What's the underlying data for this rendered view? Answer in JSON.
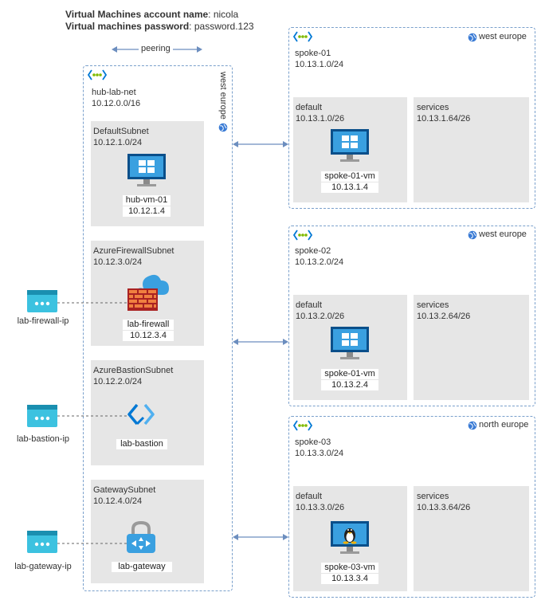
{
  "credentials": {
    "name_label": "Virtual Machines account name",
    "name_value": ": nicola",
    "password_label": "Virtual machines password",
    "password_value": ": password.123"
  },
  "peering_label": "peering",
  "hub": {
    "name": "hub-lab-net",
    "cidr": "10.12.0.0/16",
    "region": "west europe",
    "subnets": [
      {
        "name": "DefaultSubnet",
        "cidr": "10.12.1.0/24",
        "resource": "hub-vm-01",
        "ip": "10.12.1.4",
        "icon": "windows-vm-icon"
      },
      {
        "name": "AzureFirewallSubnet",
        "cidr": "10.12.3.0/24",
        "resource": "lab-firewall",
        "ip": "10.12.3.4",
        "icon": "firewall-icon"
      },
      {
        "name": "AzureBastionSubnet",
        "cidr": "10.12.2.0/24",
        "resource": "lab-bastion",
        "ip": "",
        "icon": "bastion-icon"
      },
      {
        "name": "GatewaySubnet",
        "cidr": "10.12.4.0/24",
        "resource": "lab-gateway",
        "ip": "",
        "icon": "gateway-icon"
      }
    ]
  },
  "public_ips": [
    {
      "name": "lab-firewall-ip"
    },
    {
      "name": "lab-bastion-ip"
    },
    {
      "name": "lab-gateway-ip"
    }
  ],
  "spokes": [
    {
      "name": "spoke-01",
      "cidr": "10.13.1.0/24",
      "region": "west europe",
      "default": {
        "name": "default",
        "cidr": "10.13.1.0/26",
        "vm": "spoke-01-vm",
        "ip": "10.13.1.4",
        "icon": "windows-vm-icon"
      },
      "services": {
        "name": "services",
        "cidr": "10.13.1.64/26"
      }
    },
    {
      "name": "spoke-02",
      "cidr": "10.13.2.0/24",
      "region": "west europe",
      "default": {
        "name": "default",
        "cidr": "10.13.2.0/26",
        "vm": "spoke-01-vm",
        "ip": "10.13.2.4",
        "icon": "windows-vm-icon"
      },
      "services": {
        "name": "services",
        "cidr": "10.13.2.64/26"
      }
    },
    {
      "name": "spoke-03",
      "cidr": "10.13.3.0/24",
      "region": "north europe",
      "default": {
        "name": "default",
        "cidr": "10.13.3.0/26",
        "vm": "spoke-03-vm",
        "ip": "10.13.3.4",
        "icon": "linux-vm-icon"
      },
      "services": {
        "name": "services",
        "cidr": "10.13.3.64/26"
      }
    }
  ],
  "colors": {
    "vnet_border": "#7aa0cc",
    "subnet_fill": "#e6e6e6",
    "arrow": "#6c8ebf",
    "azure_blue": "#0078d4",
    "pubip_teal": "#3cc2e0"
  }
}
